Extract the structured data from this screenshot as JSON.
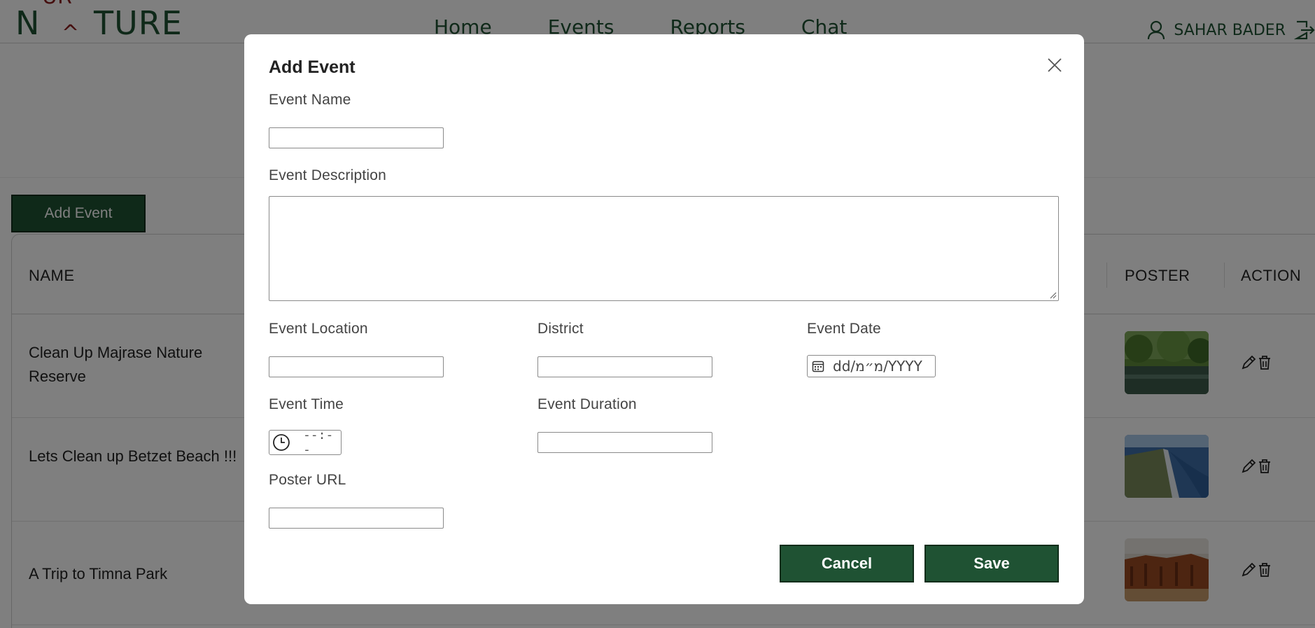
{
  "logo": {
    "left_word": "N",
    "right_word": "TURE",
    "top_letters": "UR",
    "caret": "^"
  },
  "nav": [
    "Home",
    "Events",
    "Reports",
    "Chat"
  ],
  "user": {
    "name": "SAHAR BADER"
  },
  "page": {
    "add_event_button": "Add Event"
  },
  "table": {
    "headers": {
      "name": "NAME",
      "poster": "POSTER",
      "action": "ACTION"
    },
    "rows": [
      {
        "name": "Clean Up Majrase Nature Reserve",
        "poster_icon": "forest-river-image"
      },
      {
        "name": "Lets Clean up Betzet Beach !!!",
        "poster_icon": "coastline-image"
      },
      {
        "name": "A Trip to Timna Park",
        "poster_icon": "desert-cliffs-image"
      }
    ]
  },
  "modal": {
    "title": "Add Event",
    "labels": {
      "event_name": "Event Name",
      "event_description": "Event Description",
      "event_location": "Event Location",
      "district": "District",
      "event_date": "Event Date",
      "event_time": "Event Time",
      "event_duration": "Event Duration",
      "poster_url": "Poster URL"
    },
    "values": {
      "event_name": "",
      "event_description": "",
      "event_location": "",
      "district": "",
      "event_duration": "",
      "poster_url": ""
    },
    "date_placeholder": "dd/מ״מ/YYYY",
    "time_placeholder": "--:--",
    "cancel": "Cancel",
    "save": "Save"
  },
  "colors": {
    "primary": "#1f5233",
    "logo_accent": "#8a1c1c",
    "overlay": "rgba(0,0,0,0.5)"
  }
}
